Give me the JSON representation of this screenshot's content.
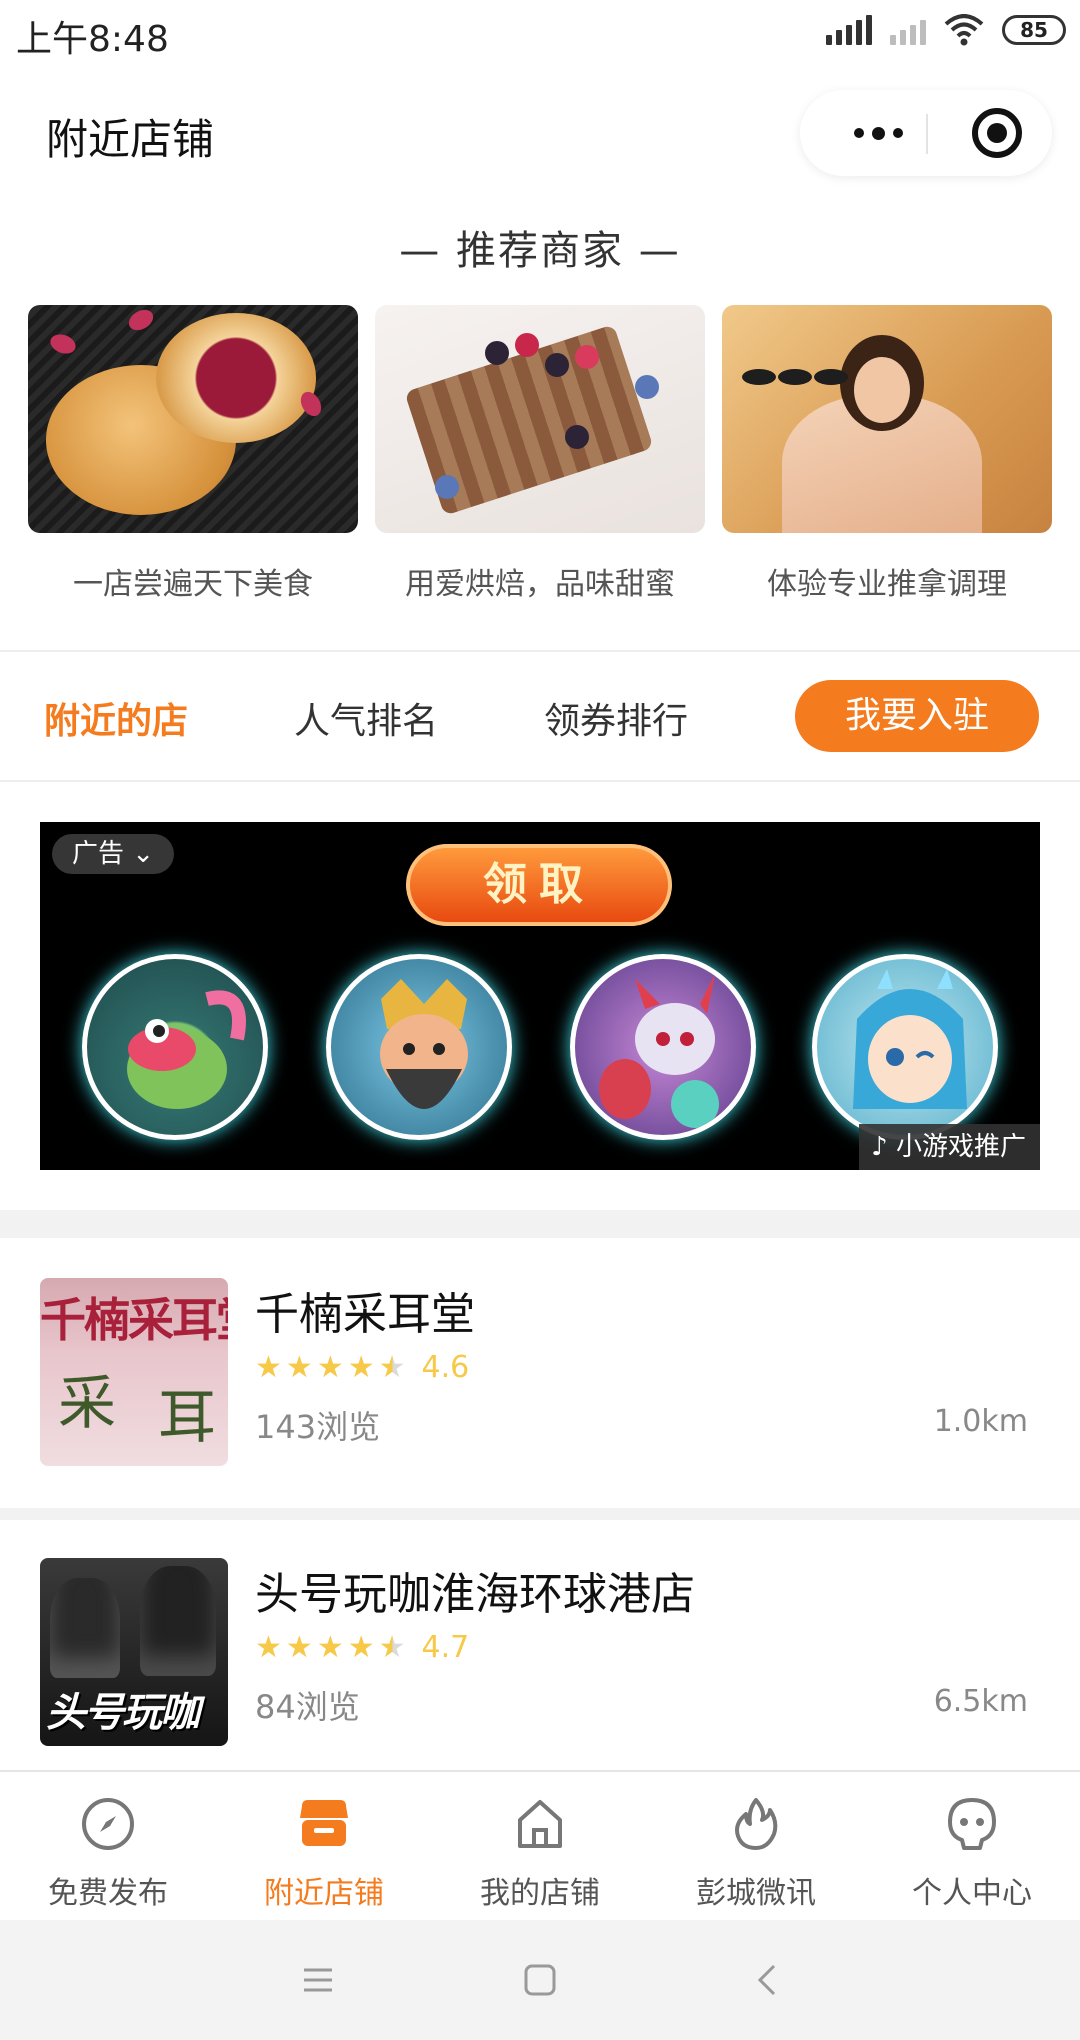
{
  "status_bar": {
    "time": "上午8:48",
    "battery": "85"
  },
  "header": {
    "title": "附近店铺"
  },
  "recommend": {
    "title": "— 推荐商家 —",
    "cards": [
      {
        "caption": "一店尝遍天下美食",
        "image": "pastry-photo"
      },
      {
        "caption": "用爱烘焙，品味甜蜜",
        "image": "waffle-photo"
      },
      {
        "caption": "体验专业推拿调理",
        "image": "spa-photo"
      }
    ]
  },
  "tabs": {
    "items": [
      "附近的店",
      "人气排名",
      "领券排行"
    ],
    "active": 0,
    "join_label": "我要入驻"
  },
  "ad": {
    "label": "广告",
    "claim_label": "领取",
    "tag": "小游戏推广"
  },
  "shops": [
    {
      "name": "千楠采耳堂",
      "rating": 4.6,
      "rating_text": "4.6",
      "views": "143浏览",
      "distance": "1.0km",
      "thumb_text": [
        "千楠采耳堂",
        "采",
        "耳"
      ]
    },
    {
      "name": "头号玩咖淮海环球港店",
      "rating": 4.7,
      "rating_text": "4.7",
      "views": "84浏览",
      "distance": "6.5km",
      "thumb_text": [
        "头号玩咖"
      ]
    }
  ],
  "bottom_nav": {
    "items": [
      {
        "label": "免费发布",
        "icon": "compass-icon"
      },
      {
        "label": "附近店铺",
        "icon": "store-icon"
      },
      {
        "label": "我的店铺",
        "icon": "home-icon"
      },
      {
        "label": "彭城微讯",
        "icon": "flame-icon"
      },
      {
        "label": "个人中心",
        "icon": "face-icon"
      }
    ],
    "active": 1
  },
  "colors": {
    "accent": "#f47b1e",
    "star": "#f7c948"
  }
}
